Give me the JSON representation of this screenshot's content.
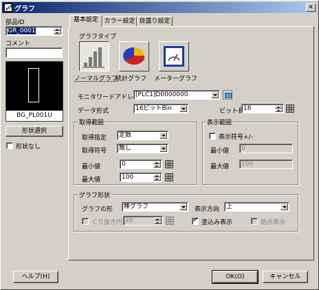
{
  "window": {
    "title": "グラフ",
    "close_label": "✕"
  },
  "left": {
    "part_id_label": "部品ID",
    "part_id_value": "GR_0001",
    "comment_label": "コメント",
    "comment_value": "",
    "preview_caption": "BG_PL001U",
    "shape_select_label": "形状選択",
    "no_shape_label": "形状なし"
  },
  "tabs": [
    "基本設定",
    "カラー設定",
    "目盛り設定"
  ],
  "graph_type": {
    "label": "グラフタイプ",
    "options": [
      "ノーマルグラフ",
      "統計グラフ",
      "メーターグラフ"
    ],
    "selected": "ノーマルグラフ"
  },
  "monitor": {
    "address_label": "モニタワードアドレス",
    "address_value": "[PLC1]D0000000",
    "data_format_label": "データ形式",
    "data_format_value": "16ビットBin",
    "bit_length_label": "ビット長",
    "bit_length_value": "16"
  },
  "acquire_range": {
    "title": "取得範囲",
    "spec_label": "取得指定",
    "spec_value": "定数",
    "sign_label": "取得符号",
    "sign_value": "無し",
    "min_label": "最小値",
    "min_value": "0",
    "max_label": "最大値",
    "max_value": "100"
  },
  "display_range": {
    "title": "表示範囲",
    "show_sign_label": "表示符号+/-",
    "min_label": "最小値",
    "min_value": "0",
    "max_label": "最大値",
    "max_value": "100"
  },
  "graph_shape": {
    "title": "グラフ形状",
    "shape_label": "グラフの形",
    "shape_value": "棒グラフ",
    "direction_label": "表示方向",
    "direction_value": "上",
    "cutout_label": "くり抜き円",
    "cutout_value": "20",
    "fill_label": "塗込み表示",
    "start_point_label": "始点表示"
  },
  "footer": {
    "help_label": "ヘルプ(H)",
    "ok_label": "OK(O)",
    "cancel_label": "キャンセル"
  },
  "colors": {
    "title_start": "#0a246a",
    "title_end": "#a6caf0",
    "face": "#d4d0c8"
  }
}
